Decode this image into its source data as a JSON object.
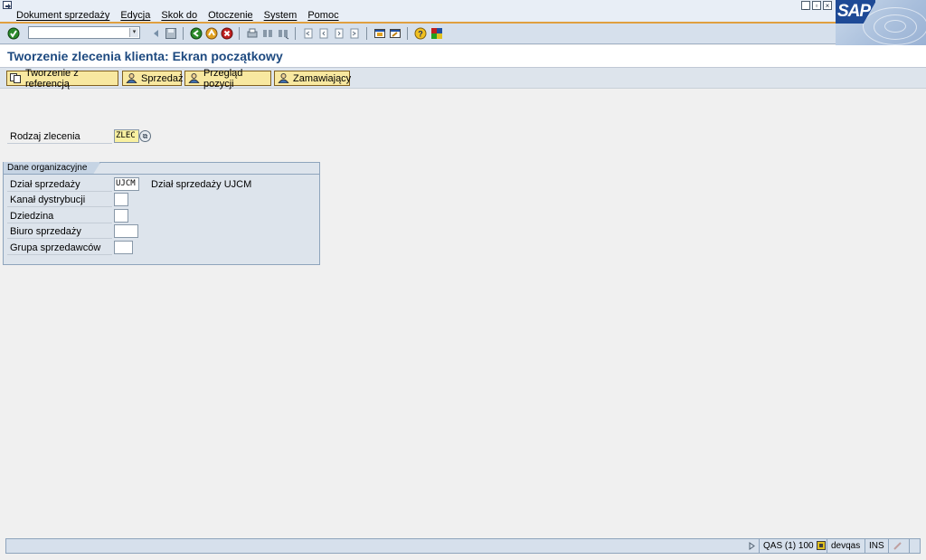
{
  "menu": {
    "items": [
      "Dokument sprzedaży",
      "Edycja",
      "Skok do",
      "Otoczenie",
      "System",
      "Pomoc"
    ]
  },
  "window_controls": [
    "minimize-icon",
    "restore-icon",
    "close-icon"
  ],
  "logo_text": "SAP",
  "toolbar": {
    "command_field_value": "",
    "icons": [
      "enter-icon",
      "command-dropdown-icon",
      "back-arrow-icon",
      "save-icon",
      "back-icon",
      "exit-icon",
      "cancel-icon",
      "print-icon",
      "find-icon",
      "find-next-icon",
      "first-page-icon",
      "previous-page-icon",
      "next-page-icon",
      "last-page-icon",
      "new-session-icon",
      "shortcut-icon",
      "help-icon",
      "layout-menu-icon"
    ]
  },
  "title": "Tworzenie zlecenia klienta: Ekran początkowy",
  "app_toolbar": {
    "buttons": [
      {
        "label": "Tworzenie z referencją",
        "icon": "copy-icon"
      },
      {
        "label": "Sprzedaż",
        "icon": "person-icon"
      },
      {
        "label": "Przegląd pozycji",
        "icon": "person-icon"
      },
      {
        "label": "Zamawiający",
        "icon": "person-icon"
      }
    ]
  },
  "form": {
    "order_type": {
      "label": "Rodzaj zlecenia",
      "value": "ZLEC"
    },
    "org_group": {
      "title": "Dane organizacyjne",
      "sales_org": {
        "label": "Dział sprzedaży",
        "value": "UJCM",
        "description": "Dział sprzedaży UJCM"
      },
      "distribution_channel": {
        "label": "Kanał dystrybucji",
        "value": ""
      },
      "division": {
        "label": "Dziedzina",
        "value": ""
      },
      "sales_office": {
        "label": "Biuro sprzedaży",
        "value": ""
      },
      "sales_group": {
        "label": "Grupa sprzedawców",
        "value": ""
      }
    }
  },
  "status": {
    "system": "QAS (1) 100",
    "server": "devqas",
    "mode": "INS"
  },
  "colors": {
    "title_text": "#1e4a80",
    "button_bg": "#f8e8a0",
    "logo_blue": "#1e4a96",
    "menu_underline": "#e0a040"
  }
}
